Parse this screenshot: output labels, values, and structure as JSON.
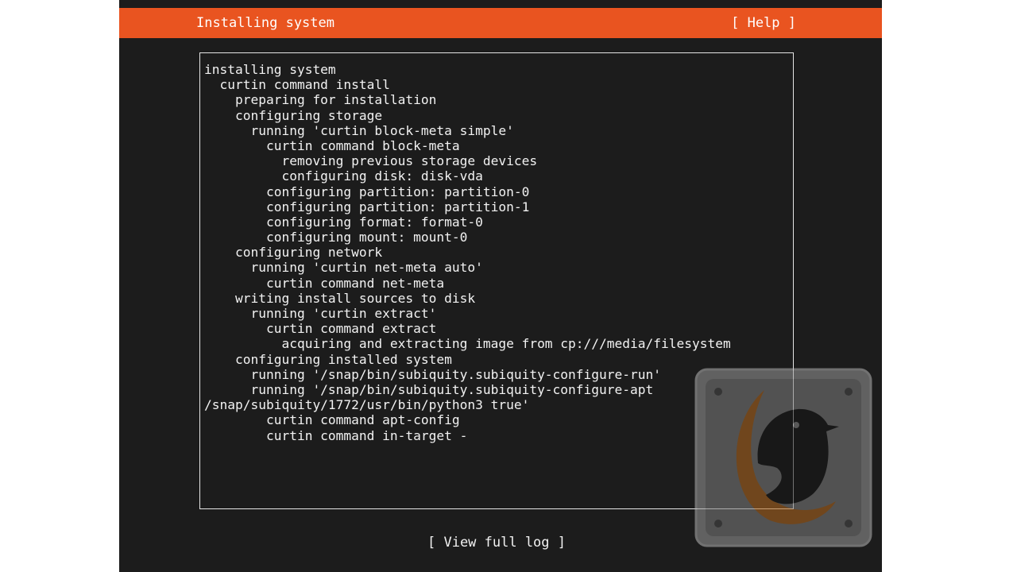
{
  "header": {
    "title": "Installing system",
    "help_label": "[ Help ]"
  },
  "log": {
    "lines": [
      "installing system",
      "  curtin command install",
      "    preparing for installation",
      "    configuring storage",
      "      running 'curtin block-meta simple'",
      "        curtin command block-meta",
      "          removing previous storage devices",
      "          configuring disk: disk-vda",
      "        configuring partition: partition-0",
      "        configuring partition: partition-1",
      "        configuring format: format-0",
      "        configuring mount: mount-0",
      "    configuring network",
      "      running 'curtin net-meta auto'",
      "        curtin command net-meta",
      "    writing install sources to disk",
      "      running 'curtin extract'",
      "        curtin command extract",
      "          acquiring and extracting image from cp:///media/filesystem",
      "    configuring installed system",
      "      running '/snap/bin/subiquity.subiquity-configure-run'",
      "      running '/snap/bin/subiquity.subiquity-configure-apt",
      "/snap/subiquity/1772/usr/bin/python3 true'",
      "        curtin command apt-config",
      "        curtin command in-target -"
    ]
  },
  "footer": {
    "view_log_label": "[ View full log ]"
  },
  "colors": {
    "accent": "#e95420",
    "background": "#1c1c1c",
    "text": "#f2f2f2"
  },
  "watermark": {
    "icon": "penguin-logo-icon"
  }
}
